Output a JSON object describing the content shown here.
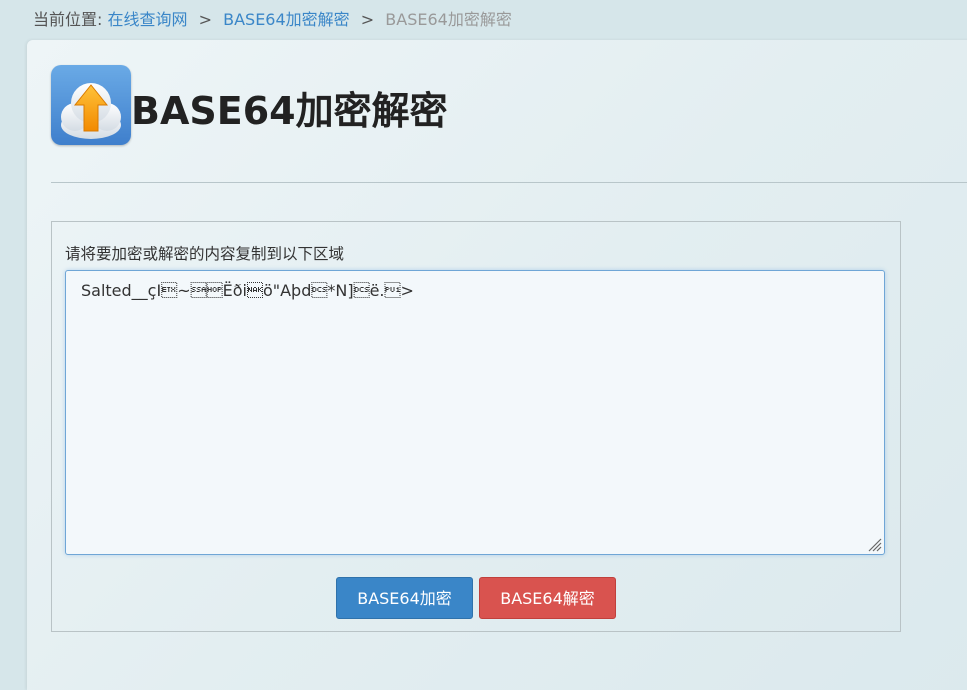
{
  "breadcrumb": {
    "prefix": "当前位置:",
    "items": [
      {
        "label": "在线查询网"
      },
      {
        "label": "BASE64加密解密"
      },
      {
        "label": "BASE64加密解密"
      }
    ],
    "separator": ">"
  },
  "header": {
    "title": "BASE64加密解密",
    "icon": "cloud-upload-icon"
  },
  "form": {
    "label": "请将要加密或解密的内容复制到以下区域",
    "textarea_value": "Salted__çI\u0003~Ëði\u0015ö\"Aþd*N]ë.>",
    "buttons": {
      "encode_label": "BASE64加密",
      "decode_label": "BASE64解密"
    }
  },
  "colors": {
    "link": "#3a86c8",
    "primary": "#3a86c8",
    "danger": "#d9534f",
    "background": "#d6e6ea"
  }
}
